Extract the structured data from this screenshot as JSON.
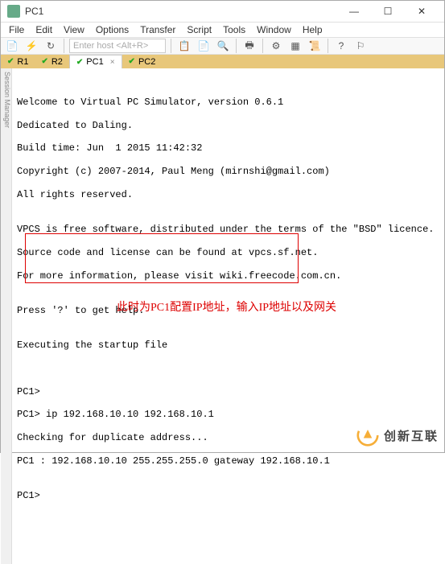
{
  "window": {
    "title": "PC1"
  },
  "menu": {
    "items": [
      "File",
      "Edit",
      "View",
      "Options",
      "Transfer",
      "Script",
      "Tools",
      "Window",
      "Help"
    ]
  },
  "toolbar": {
    "host_placeholder": "Enter host <Alt+R>"
  },
  "tabs": [
    {
      "label": "R1",
      "active": false
    },
    {
      "label": "R2",
      "active": false
    },
    {
      "label": "PC1",
      "active": true
    },
    {
      "label": "PC2",
      "active": false
    }
  ],
  "sidebar": {
    "label": "Session Manager"
  },
  "terminal": {
    "lines": [
      "",
      "Welcome to Virtual PC Simulator, version 0.6.1",
      "Dedicated to Daling.",
      "Build time: Jun  1 2015 11:42:32",
      "Copyright (c) 2007-2014, Paul Meng (mirnshi@gmail.com)",
      "All rights reserved.",
      "",
      "VPCS is free software, distributed under the terms of the \"BSD\" licence.",
      "Source code and license can be found at vpcs.sf.net.",
      "For more information, please visit wiki.freecode.com.cn.",
      "",
      "Press '?' to get help.",
      "",
      "Executing the startup file",
      "",
      "",
      "PC1>",
      "PC1> ip 192.168.10.10 192.168.10.1",
      "Checking for duplicate address...",
      "PC1 : 192.168.10.10 255.255.255.0 gateway 192.168.10.1",
      "",
      "PC1>"
    ]
  },
  "annotation": {
    "text": "此时为PC1配置IP地址，输入IP地址以及网关"
  },
  "watermark": {
    "text": "创新互联"
  }
}
